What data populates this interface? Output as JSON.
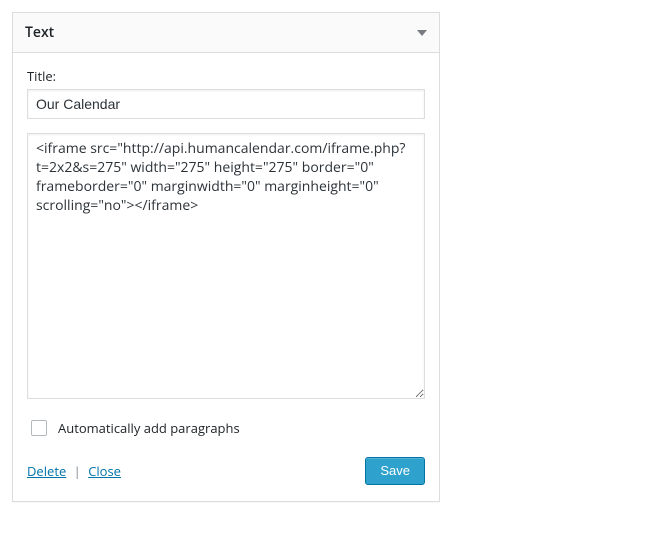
{
  "widget": {
    "header_title": "Text",
    "title_label": "Title:",
    "title_value": "Our Calendar",
    "content_value": "<iframe src=\"http://api.humancalendar.com/iframe.php?t=2x2&s=275\" width=\"275\" height=\"275\" border=\"0\" frameborder=\"0\" marginwidth=\"0\" marginheight=\"0\" scrolling=\"no\"></iframe>",
    "auto_p_label": "Automatically add paragraphs",
    "actions": {
      "delete": "Delete",
      "close": "Close",
      "save": "Save"
    }
  }
}
